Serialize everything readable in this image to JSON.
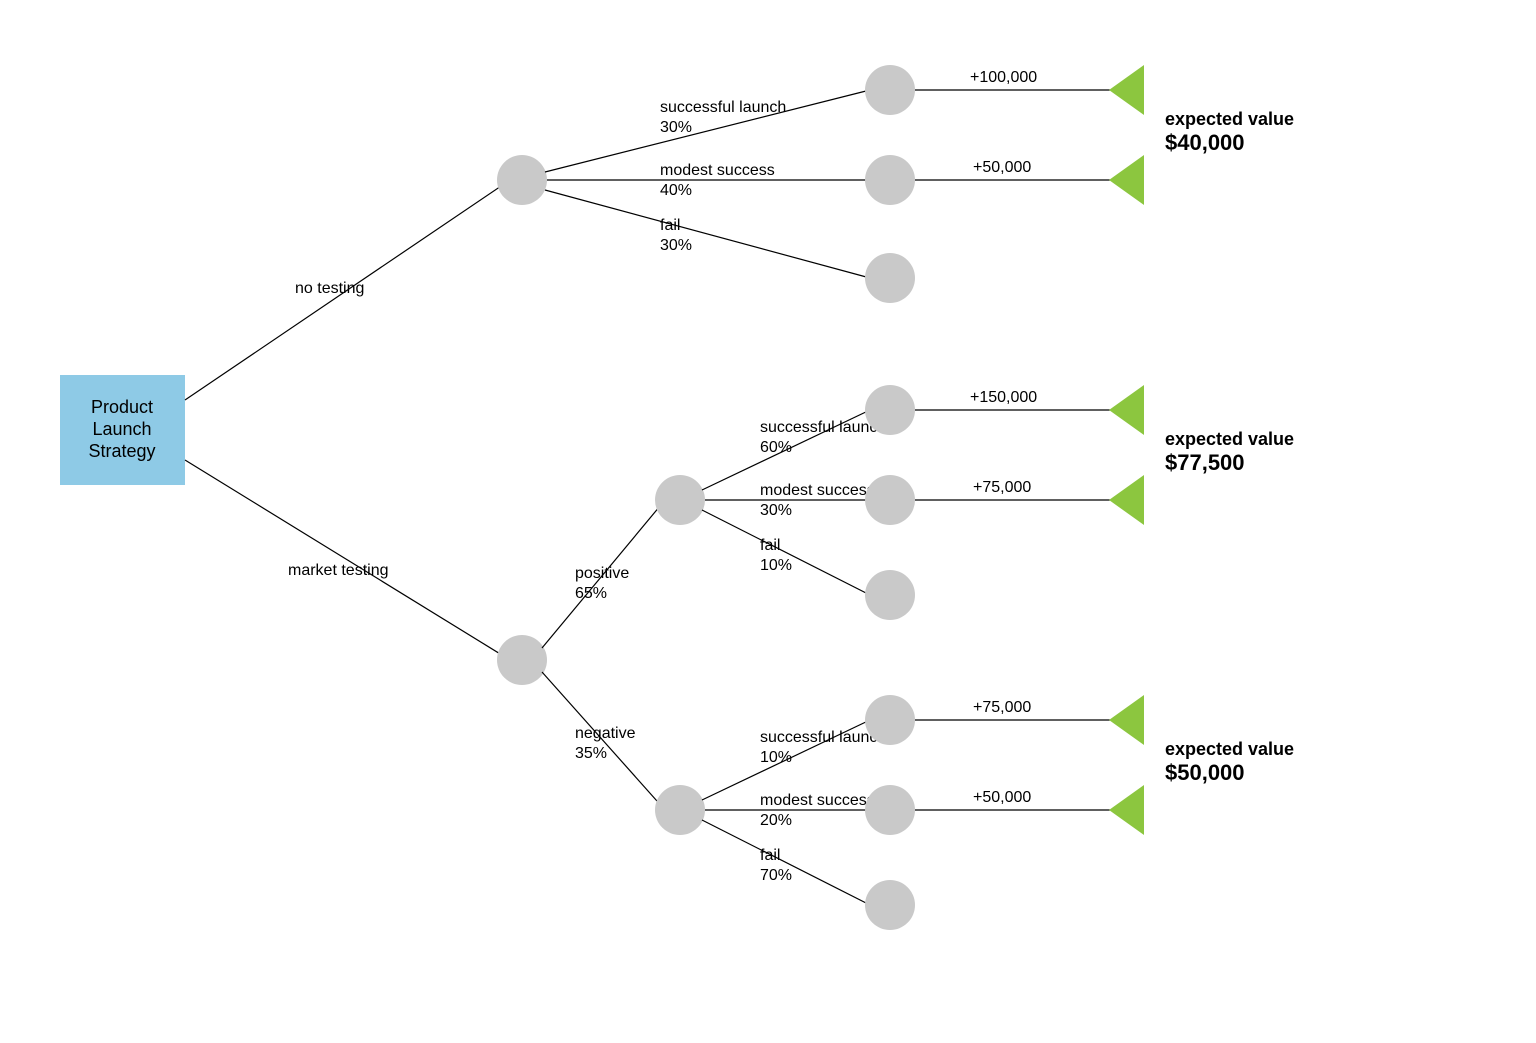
{
  "chart_data": {
    "type": "decision-tree",
    "root": {
      "label_line1": "Product",
      "label_line2": "Launch",
      "label_line3": "Strategy"
    },
    "decisions": [
      {
        "name": "no testing",
        "outcomes": [
          {
            "label": "successful launch",
            "prob": "30%",
            "payoff": "+100,000"
          },
          {
            "label": "modest success",
            "prob": "40%",
            "payoff": "+50,000"
          },
          {
            "label": "fail",
            "prob": "30%"
          }
        ],
        "expected_value_label": "expected value",
        "expected_value": "$40,000"
      },
      {
        "name": "market testing",
        "tests": [
          {
            "label": "positive",
            "prob": "65%",
            "outcomes": [
              {
                "label": "successful launch",
                "prob": "60%",
                "payoff": "+150,000"
              },
              {
                "label": "modest success",
                "prob": "30%",
                "payoff": "+75,000"
              },
              {
                "label": "fail",
                "prob": "10%"
              }
            ],
            "expected_value_label": "expected value",
            "expected_value": "$77,500"
          },
          {
            "label": "negative",
            "prob": "35%",
            "outcomes": [
              {
                "label": "successful launch",
                "prob": "10%",
                "payoff": "+75,000"
              },
              {
                "label": "modest success",
                "prob": "20%",
                "payoff": "+50,000"
              },
              {
                "label": "fail",
                "prob": "70%"
              }
            ],
            "expected_value_label": "expected value",
            "expected_value": "$50,000"
          }
        ]
      }
    ]
  },
  "colors": {
    "root_box": "#8ecae6",
    "chance": "#c9c9c9",
    "end": "#8cc63f"
  }
}
